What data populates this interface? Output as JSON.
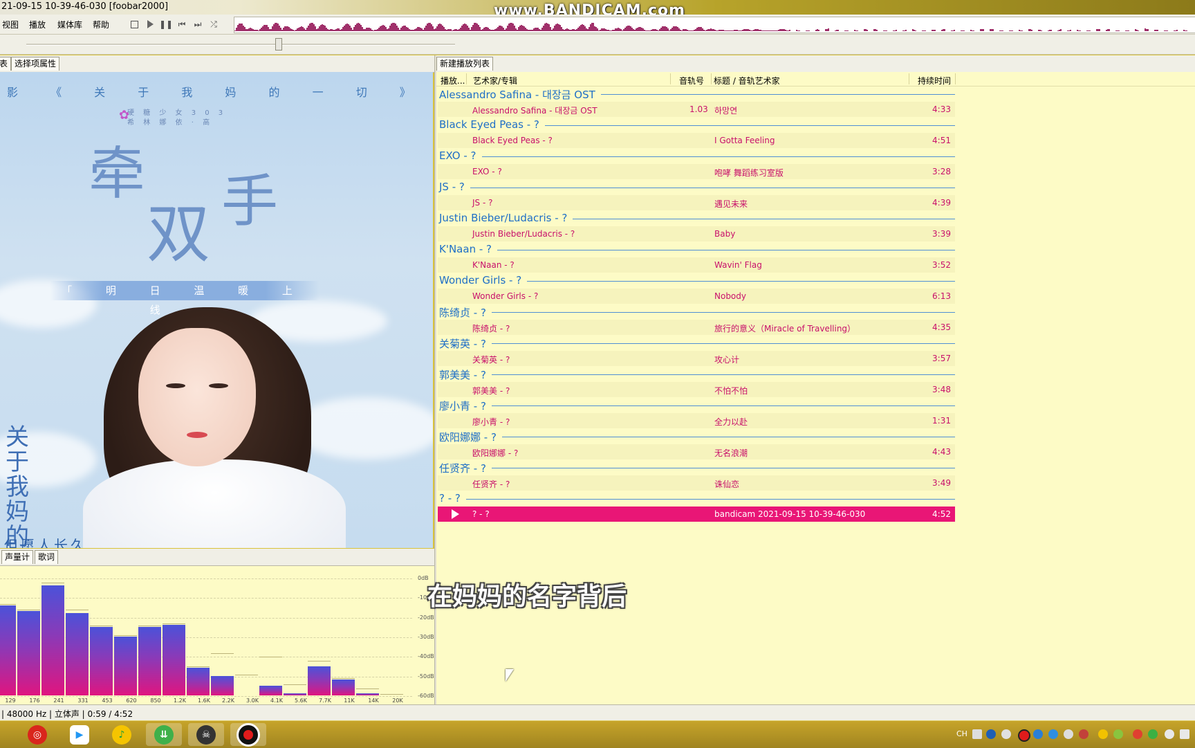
{
  "window": {
    "title": "21-09-15 10-39-46-030  [foobar2000]",
    "watermark": "www.BANDICAM.com"
  },
  "menu": {
    "items": [
      "视图",
      "播放",
      "媒体库",
      "帮助"
    ]
  },
  "toolbar": {
    "buttons": [
      "stop",
      "play",
      "pause",
      "previous",
      "next",
      "random"
    ]
  },
  "left_panel": {
    "tabs": [
      "表",
      "选择项属性"
    ],
    "cover": {
      "headline": "影 《 关 于 我 妈 的 一 切 》 主 题 曲",
      "sub_line1": "硬 糖 少 女 3 0 3",
      "sub_line2": "希 林 娜 依 · 高",
      "title_chars": [
        "牵",
        "双",
        "手"
      ],
      "band": "「 明 日 温 暖 上 线 」",
      "vertical_title": "关于我妈的一切",
      "bottom_text": "但愿人长久"
    }
  },
  "spectrum_panel": {
    "tabs": [
      "声量计",
      "歌词"
    ],
    "db_labels": [
      "0dB",
      "-10dB",
      "-20dB",
      "-30dB",
      "-40dB",
      "-50dB",
      "-60dB"
    ],
    "freq_labels": [
      "129",
      "176",
      "241",
      "331",
      "453",
      "620",
      "850",
      "1.2K",
      "1.6K",
      "2.2K",
      "3.0K",
      "4.1K",
      "5.6K",
      "7.7K",
      "11K",
      "14K",
      "20K"
    ],
    "levels_db": [
      -14,
      -17,
      -4,
      -18,
      -25,
      -30,
      -25,
      -24,
      -46,
      -50,
      -60,
      -55,
      -59,
      -45,
      -52,
      -59,
      -60
    ],
    "peaks_db": [
      -14,
      -17,
      -3,
      -17,
      -25,
      -30,
      -25,
      -24,
      -46,
      -39,
      -50,
      -41,
      -55,
      -43,
      -52,
      -57,
      -60
    ]
  },
  "playlist": {
    "tab": "新建播放列表",
    "columns": [
      "播放...",
      "艺术家/专辑",
      "音轨号",
      "标题 / 音轨艺术家",
      "持续时间"
    ],
    "groups": [
      {
        "header": "Alessandro Safina - 대장금 OST",
        "track": {
          "artist_album": "Alessandro Safina - 대장금 OST",
          "track_no": "1.03",
          "title": "하망연",
          "duration": "4:33"
        }
      },
      {
        "header": "Black Eyed Peas - ?",
        "track": {
          "artist_album": "Black Eyed Peas - ?",
          "track_no": "",
          "title": "I Gotta Feeling",
          "duration": "4:51"
        }
      },
      {
        "header": "EXO - ?",
        "track": {
          "artist_album": "EXO - ?",
          "track_no": "",
          "title": "咆哮 舞蹈练习室版",
          "duration": "3:28"
        }
      },
      {
        "header": "JS - ?",
        "track": {
          "artist_album": "JS - ?",
          "track_no": "",
          "title": "遇见未来",
          "duration": "4:39"
        }
      },
      {
        "header": "Justin Bieber/Ludacris - ?",
        "track": {
          "artist_album": "Justin Bieber/Ludacris - ?",
          "track_no": "",
          "title": "Baby",
          "duration": "3:39"
        }
      },
      {
        "header": "K'Naan - ?",
        "track": {
          "artist_album": "K'Naan - ?",
          "track_no": "",
          "title": "Wavin' Flag",
          "duration": "3:52"
        }
      },
      {
        "header": "Wonder Girls - ?",
        "track": {
          "artist_album": "Wonder Girls - ?",
          "track_no": "",
          "title": "Nobody",
          "duration": "6:13"
        }
      },
      {
        "header": "陈绮贞 - ?",
        "track": {
          "artist_album": "陈绮贞 - ?",
          "track_no": "",
          "title": "旅行的意义（Miracle of Travelling）",
          "duration": "4:35"
        }
      },
      {
        "header": "关菊英 - ?",
        "track": {
          "artist_album": "关菊英 - ?",
          "track_no": "",
          "title": "攻心计",
          "duration": "3:57"
        }
      },
      {
        "header": "郭美美 - ?",
        "track": {
          "artist_album": "郭美美 - ?",
          "track_no": "",
          "title": "不怕不怕",
          "duration": "3:48"
        }
      },
      {
        "header": "廖小青 - ?",
        "track": {
          "artist_album": "廖小青 - ?",
          "track_no": "",
          "title": "全力以赴",
          "duration": "1:31"
        }
      },
      {
        "header": "欧阳娜娜 - ?",
        "track": {
          "artist_album": "欧阳娜娜 - ?",
          "track_no": "",
          "title": "无名浪潮",
          "duration": "4:43"
        }
      },
      {
        "header": "任贤齐 - ?",
        "track": {
          "artist_album": "任贤齐 - ?",
          "track_no": "",
          "title": "诛仙恋",
          "duration": "3:49"
        }
      },
      {
        "header": "? - ?",
        "track": {
          "artist_album": "? - ?",
          "track_no": "",
          "title": "bandicam 2021-09-15 10-39-46-030",
          "duration": "4:52",
          "playing": true
        }
      }
    ]
  },
  "subtitle": "在妈妈的名字背后",
  "status": "| 48000 Hz | 立体声 | 0:59 / 4:52",
  "tray": {
    "lang": "CH"
  },
  "colors": {
    "playlist_bg": "#fdfbc6",
    "group_text": "#1f6fc6",
    "track_text": "#c8106b",
    "playing_row": "#e91676"
  }
}
